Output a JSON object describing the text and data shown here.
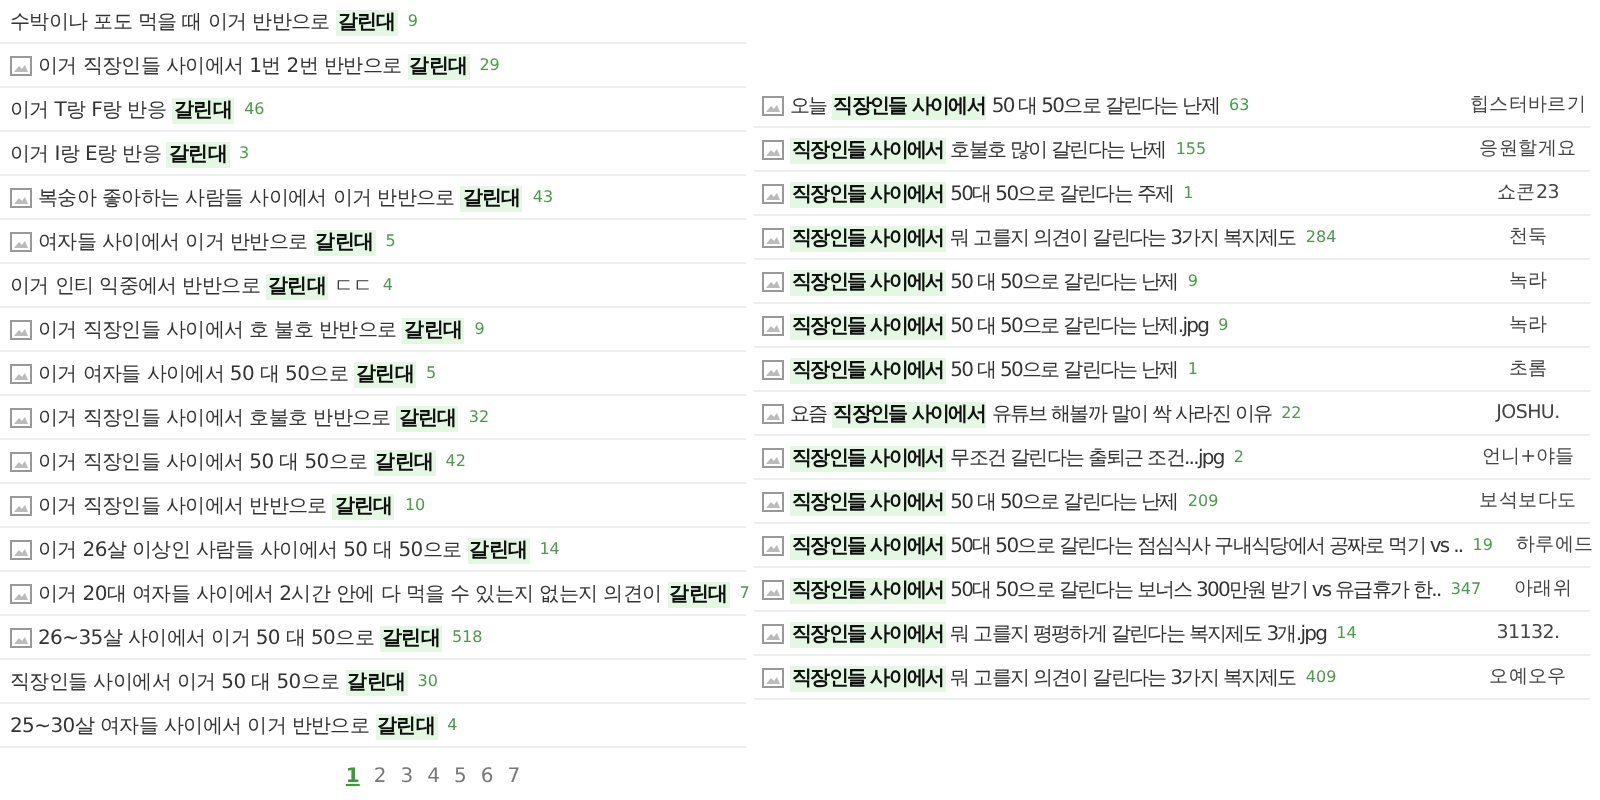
{
  "left_posts": [
    {
      "image": false,
      "parts": [
        {
          "text": "수박이나 포도 먹을 때 이거 반반으로 ",
          "highlight": false
        },
        {
          "text": "갈린대",
          "highlight": true
        }
      ],
      "count": "9"
    },
    {
      "image": true,
      "parts": [
        {
          "text": "이거 직장인들 사이에서 1번 2번 반반으로 ",
          "highlight": false
        },
        {
          "text": "갈린대",
          "highlight": true
        }
      ],
      "count": "29"
    },
    {
      "image": false,
      "parts": [
        {
          "text": "이거 T랑 F랑 반응 ",
          "highlight": false
        },
        {
          "text": "갈린대",
          "highlight": true
        }
      ],
      "count": "46"
    },
    {
      "image": false,
      "parts": [
        {
          "text": "이거 I랑 E랑 반응 ",
          "highlight": false
        },
        {
          "text": "갈린대",
          "highlight": true
        }
      ],
      "count": "3"
    },
    {
      "image": true,
      "parts": [
        {
          "text": "복숭아 좋아하는 사람들 사이에서 이거 반반으로 ",
          "highlight": false
        },
        {
          "text": "갈린대",
          "highlight": true
        }
      ],
      "count": "43"
    },
    {
      "image": true,
      "parts": [
        {
          "text": "여자들 사이에서 이거 반반으로 ",
          "highlight": false
        },
        {
          "text": "갈린대",
          "highlight": true
        }
      ],
      "count": "5"
    },
    {
      "image": false,
      "parts": [
        {
          "text": "이거 인티 익중에서 반반으로 ",
          "highlight": false
        },
        {
          "text": "갈린대",
          "highlight": true
        },
        {
          "text": " ㄷㄷ",
          "highlight": false
        }
      ],
      "count": "4"
    },
    {
      "image": true,
      "parts": [
        {
          "text": "이거 직장인들 사이에서 호 불호 반반으로 ",
          "highlight": false
        },
        {
          "text": "갈린대",
          "highlight": true
        }
      ],
      "count": "9"
    },
    {
      "image": true,
      "parts": [
        {
          "text": "이거 여자들 사이에서 50 대 50으로 ",
          "highlight": false
        },
        {
          "text": "갈린대",
          "highlight": true
        }
      ],
      "count": "5"
    },
    {
      "image": true,
      "parts": [
        {
          "text": "이거 직장인들 사이에서 호불호 반반으로 ",
          "highlight": false
        },
        {
          "text": "갈린대",
          "highlight": true
        }
      ],
      "count": "32"
    },
    {
      "image": true,
      "parts": [
        {
          "text": "이거 직장인들 사이에서 50 대 50으로 ",
          "highlight": false
        },
        {
          "text": "갈린대",
          "highlight": true
        }
      ],
      "count": "42"
    },
    {
      "image": true,
      "parts": [
        {
          "text": "이거 직장인들 사이에서 반반으로 ",
          "highlight": false
        },
        {
          "text": "갈린대",
          "highlight": true
        }
      ],
      "count": "10"
    },
    {
      "image": true,
      "parts": [
        {
          "text": "이거 26살 이상인 사람들 사이에서 50 대 50으로 ",
          "highlight": false
        },
        {
          "text": "갈린대",
          "highlight": true
        }
      ],
      "count": "14"
    },
    {
      "image": true,
      "parts": [
        {
          "text": "이거 20대 여자들 사이에서 2시간 안에 다 먹을 수 있는지 없는지 의견이 ",
          "highlight": false
        },
        {
          "text": "갈린대",
          "highlight": true
        }
      ],
      "count": "7"
    },
    {
      "image": true,
      "parts": [
        {
          "text": "26~35살 사이에서 이거 50 대 50으로 ",
          "highlight": false
        },
        {
          "text": "갈린대",
          "highlight": true
        }
      ],
      "count": "518"
    },
    {
      "image": false,
      "parts": [
        {
          "text": "직장인들 사이에서 이거 50 대 50으로 ",
          "highlight": false
        },
        {
          "text": "갈린대",
          "highlight": true
        }
      ],
      "count": "30"
    },
    {
      "image": false,
      "parts": [
        {
          "text": "25~30살 여자들 사이에서 이거 반반으로 ",
          "highlight": false
        },
        {
          "text": "갈린대",
          "highlight": true
        }
      ],
      "count": "4"
    }
  ],
  "pagination": [
    {
      "label": "1",
      "selected": true
    },
    {
      "label": "2",
      "selected": false
    },
    {
      "label": "3",
      "selected": false
    },
    {
      "label": "4",
      "selected": false
    },
    {
      "label": "5",
      "selected": false
    },
    {
      "label": "6",
      "selected": false
    },
    {
      "label": "7",
      "selected": false
    }
  ],
  "right_posts": [
    {
      "image": true,
      "parts": [
        {
          "text": "오늘 ",
          "highlight": false
        },
        {
          "text": "직장인들 사이에서",
          "highlight": true
        },
        {
          "text": " 50 대 50으로 갈린다는 난제",
          "highlight": false
        }
      ],
      "count": "63",
      "author": "힙스터바르기"
    },
    {
      "image": true,
      "parts": [
        {
          "text": "직장인들 사이에서",
          "highlight": true
        },
        {
          "text": " 호불호 많이 갈린다는 난제",
          "highlight": false
        }
      ],
      "count": "155",
      "author": "응원할게요"
    },
    {
      "image": true,
      "parts": [
        {
          "text": "직장인들 사이에서",
          "highlight": true
        },
        {
          "text": " 50대 50으로 갈린다는 주제",
          "highlight": false
        }
      ],
      "count": "1",
      "author": "쇼콘23"
    },
    {
      "image": true,
      "parts": [
        {
          "text": "직장인들 사이에서",
          "highlight": true
        },
        {
          "text": " 뭐 고를지 의견이 갈린다는 3가지 복지제도",
          "highlight": false
        }
      ],
      "count": "284",
      "author": "천둑"
    },
    {
      "image": true,
      "parts": [
        {
          "text": "직장인들 사이에서",
          "highlight": true
        },
        {
          "text": " 50 대 50으로 갈린다는 난제",
          "highlight": false
        }
      ],
      "count": "9",
      "author": "녹라"
    },
    {
      "image": true,
      "parts": [
        {
          "text": "직장인들 사이에서",
          "highlight": true
        },
        {
          "text": " 50 대 50으로 갈린다는 난제.jpg",
          "highlight": false
        }
      ],
      "count": "9",
      "author": "녹라"
    },
    {
      "image": true,
      "parts": [
        {
          "text": "직장인들 사이에서",
          "highlight": true
        },
        {
          "text": " 50 대 50으로 갈린다는 난제",
          "highlight": false
        }
      ],
      "count": "1",
      "author": "초롬"
    },
    {
      "image": true,
      "parts": [
        {
          "text": "요즘 ",
          "highlight": false
        },
        {
          "text": "직장인들 사이에서",
          "highlight": true
        },
        {
          "text": " 유튜브 해볼까 말이 싹 사라진 이유",
          "highlight": false
        }
      ],
      "count": "22",
      "author": "JOSHU."
    },
    {
      "image": true,
      "parts": [
        {
          "text": "직장인들 사이에서",
          "highlight": true
        },
        {
          "text": " 무조건 갈린다는 출퇴근 조건...jpg",
          "highlight": false
        }
      ],
      "count": "2",
      "author": "언니+야들"
    },
    {
      "image": true,
      "parts": [
        {
          "text": "직장인들 사이에서",
          "highlight": true
        },
        {
          "text": " 50 대 50으로 갈린다는 난제",
          "highlight": false
        }
      ],
      "count": "209",
      "author": "보석보다도"
    },
    {
      "image": true,
      "parts": [
        {
          "text": "직장인들 사이에서",
          "highlight": true
        },
        {
          "text": " 50대 50으로 갈린다는 점심식사 구내식당에서 공짜로 먹기 vs ..",
          "highlight": false
        }
      ],
      "count": "19",
      "author": "하루에드"
    },
    {
      "image": true,
      "parts": [
        {
          "text": "직장인들 사이에서",
          "highlight": true
        },
        {
          "text": " 50대 50으로 갈린다는 보너스 300만원 받기 vs 유급휴가 한..",
          "highlight": false
        }
      ],
      "count": "347",
      "author": "아래위"
    },
    {
      "image": true,
      "parts": [
        {
          "text": "직장인들 사이에서",
          "highlight": true
        },
        {
          "text": " 뭐 고를지 평평하게 갈린다는 복지제도 3개.jpg",
          "highlight": false
        }
      ],
      "count": "14",
      "author": "31132."
    },
    {
      "image": true,
      "parts": [
        {
          "text": "직장인들 사이에서",
          "highlight": true
        },
        {
          "text": " 뭐 고를지 의견이 갈린다는 3가지 복지제도",
          "highlight": false
        }
      ],
      "count": "409",
      "author": "오예오우"
    }
  ]
}
